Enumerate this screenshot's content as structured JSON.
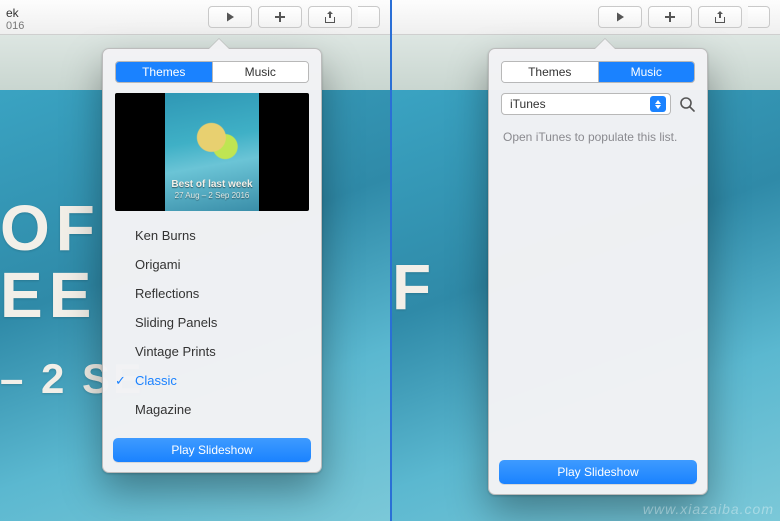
{
  "toolbar": {
    "left_title_fragment": "ek",
    "left_subtitle_fragment": "016"
  },
  "segmented": {
    "themes": "Themes",
    "music": "Music"
  },
  "preview": {
    "title": "Best of last week",
    "subtitle": "27 Aug – 2 Sep 2016"
  },
  "themes": [
    {
      "name": "Ken Burns",
      "selected": false
    },
    {
      "name": "Origami",
      "selected": false
    },
    {
      "name": "Reflections",
      "selected": false
    },
    {
      "name": "Sliding Panels",
      "selected": false
    },
    {
      "name": "Vintage Prints",
      "selected": false
    },
    {
      "name": "Classic",
      "selected": true
    },
    {
      "name": "Magazine",
      "selected": false
    }
  ],
  "play_button": "Play Slideshow",
  "music": {
    "source": "iTunes",
    "hint": "Open iTunes to populate this list."
  },
  "bg_text": {
    "line1a": "OF",
    "line1b": "EE",
    "line2": "– 2 SE",
    "right_line1": "F"
  },
  "watermark": "www.xiazaiba.com"
}
